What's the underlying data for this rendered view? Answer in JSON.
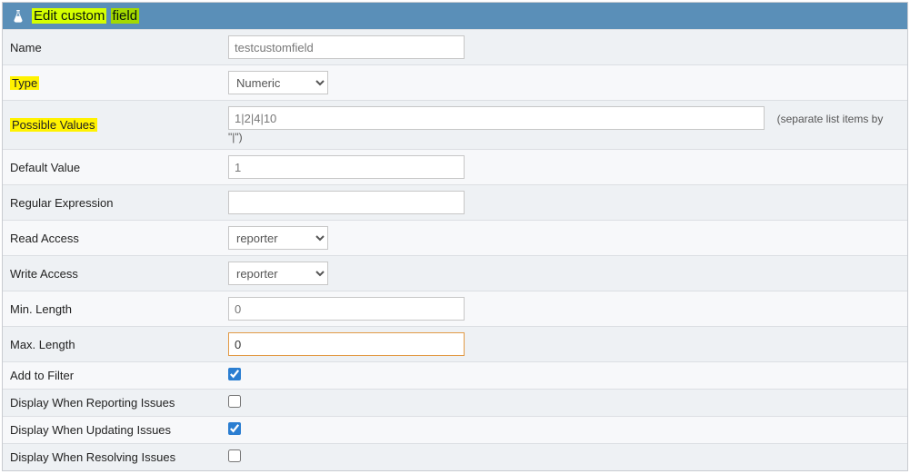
{
  "header": {
    "title_part1": "Edit custom",
    "title_part2": "field"
  },
  "labels": {
    "name": "Name",
    "type": "Type",
    "possible_values": "Possible Values",
    "default_value": "Default Value",
    "regex": "Regular Expression",
    "read_access": "Read Access",
    "write_access": "Write Access",
    "min_length": "Min. Length",
    "max_length": "Max. Length",
    "add_filter": "Add to Filter",
    "disp_report": "Display When Reporting Issues",
    "disp_update": "Display When Updating Issues",
    "disp_resolve": "Display When Resolving Issues"
  },
  "values": {
    "name": "testcustomfield",
    "type": "Numeric",
    "possible_values": "1|2|4|10",
    "default_value": "1",
    "regex": "",
    "read_access": "reporter",
    "write_access": "reporter",
    "min_length": "0",
    "max_length": "0",
    "add_filter": true,
    "disp_report": false,
    "disp_update": true,
    "disp_resolve": false
  },
  "hints": {
    "possible_values": "(separate list items by \"|\")"
  },
  "options": {
    "type": [
      "Numeric"
    ],
    "access": [
      "reporter"
    ]
  }
}
